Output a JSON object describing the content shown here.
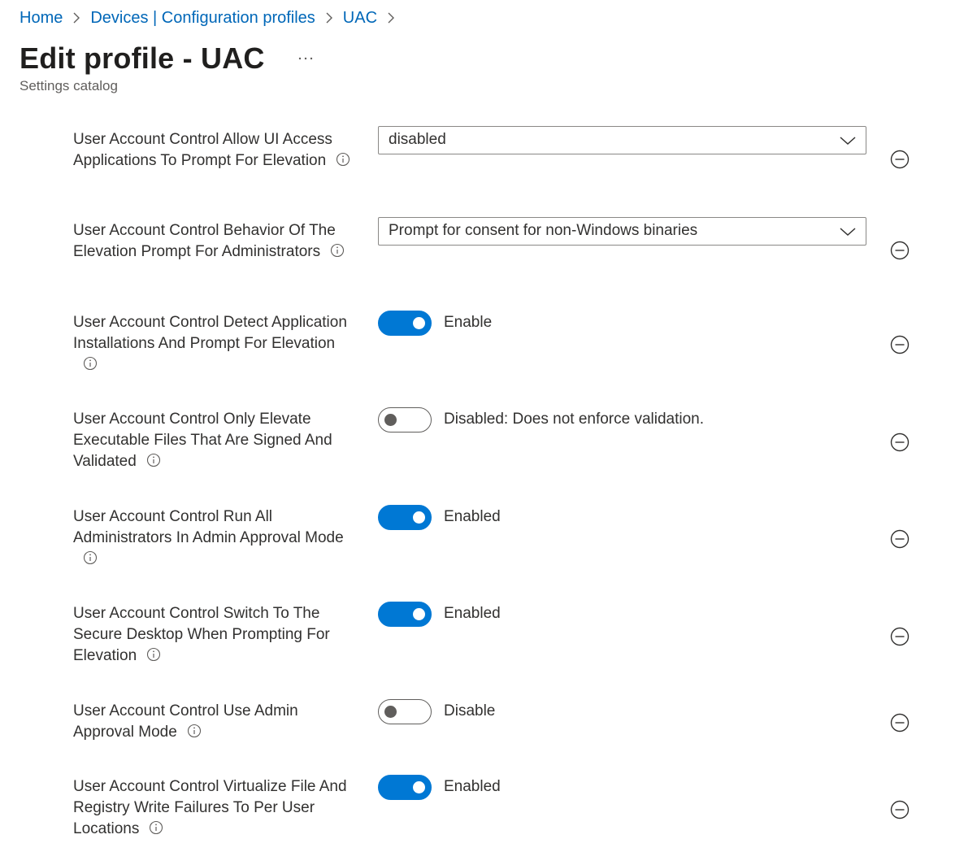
{
  "breadcrumb": {
    "items": [
      "Home",
      "Devices | Configuration profiles",
      "UAC"
    ]
  },
  "header": {
    "title": "Edit profile - UAC",
    "more_icon": "ellipsis-icon",
    "subtitle": "Settings catalog"
  },
  "colors": {
    "accent": "#0078d4",
    "link": "#0067b8",
    "text": "#323130"
  },
  "settings": [
    {
      "label_lines": [
        "User Account Control Allow UI Access",
        "Applications To Prompt For Elevation"
      ],
      "control": "dropdown",
      "value": "disabled"
    },
    {
      "label_lines": [
        "User Account Control Behavior Of The",
        "Elevation Prompt For Administrators"
      ],
      "control": "dropdown",
      "value": "Prompt for consent for non-Windows binaries"
    },
    {
      "label_lines": [
        "User Account Control Detect Application",
        "Installations And Prompt For Elevation"
      ],
      "control": "toggle",
      "state": "on",
      "value": "Enable"
    },
    {
      "label_lines": [
        "User Account Control Only Elevate",
        "Executable Files That Are Signed And",
        "Validated"
      ],
      "control": "toggle",
      "state": "off",
      "value": "Disabled: Does not enforce validation."
    },
    {
      "label_lines": [
        "User Account Control Run All",
        "Administrators In Admin Approval Mode"
      ],
      "control": "toggle",
      "state": "on",
      "value": "Enabled"
    },
    {
      "label_lines": [
        "User Account Control Switch To The",
        "Secure Desktop When Prompting For",
        "Elevation"
      ],
      "control": "toggle",
      "state": "on",
      "value": "Enabled"
    },
    {
      "label_lines": [
        "User Account Control Use Admin",
        "Approval Mode"
      ],
      "control": "toggle",
      "state": "off",
      "value": "Disable"
    },
    {
      "label_lines": [
        "User Account Control Virtualize File And",
        "Registry Write Failures To Per User",
        "Locations"
      ],
      "control": "toggle",
      "state": "on",
      "value": "Enabled"
    }
  ]
}
